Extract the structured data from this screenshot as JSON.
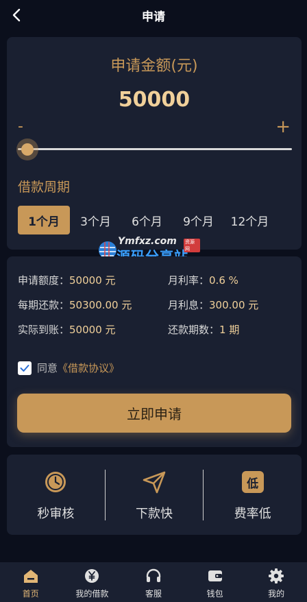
{
  "header": {
    "title": "申请"
  },
  "amount": {
    "label": "申请金额(元)",
    "value": "50000",
    "minus": "-",
    "plus": "+",
    "slider_fraction": 0.0
  },
  "period": {
    "label": "借款周期",
    "options": [
      "1个月",
      "3个月",
      "6个月",
      "9个月",
      "12个月"
    ],
    "selected_index": 0
  },
  "watermark": {
    "top": "Ymfxz.com",
    "net": "资源网",
    "bottom": "源码分享站"
  },
  "info": {
    "apply_amount_label": "申请额度：",
    "apply_amount_value": "50000 元",
    "monthly_rate_label": "月利率：",
    "monthly_rate_value": "0.6 %",
    "per_repay_label": "每期还款：",
    "per_repay_value": "50300.00 元",
    "monthly_interest_label": "月利息：",
    "monthly_interest_value": "300.00 元",
    "actual_label": "实际到账：",
    "actual_value": "50000 元",
    "periods_label": "还款期数：",
    "periods_value": "1 期"
  },
  "agreement": {
    "checked": true,
    "text": "同意",
    "link": "《借款协议》"
  },
  "apply_button": "立即申请",
  "features": [
    {
      "icon": "clock-icon",
      "label": "秒审核"
    },
    {
      "icon": "send-icon",
      "label": "下款快"
    },
    {
      "icon": "low-badge-icon",
      "label": "费率低",
      "badge": "低"
    }
  ],
  "tabbar": [
    {
      "icon": "home-icon",
      "label": "首页",
      "active": true
    },
    {
      "icon": "yen-icon",
      "label": "我的借款"
    },
    {
      "icon": "headset-icon",
      "label": "客服"
    },
    {
      "icon": "wallet-icon",
      "label": "钱包"
    },
    {
      "icon": "gear-icon",
      "label": "我的"
    }
  ],
  "colors": {
    "accent": "#c89858",
    "background": "#0b0f1c",
    "card": "#1a2031",
    "value_gold": "#f0d09a"
  }
}
